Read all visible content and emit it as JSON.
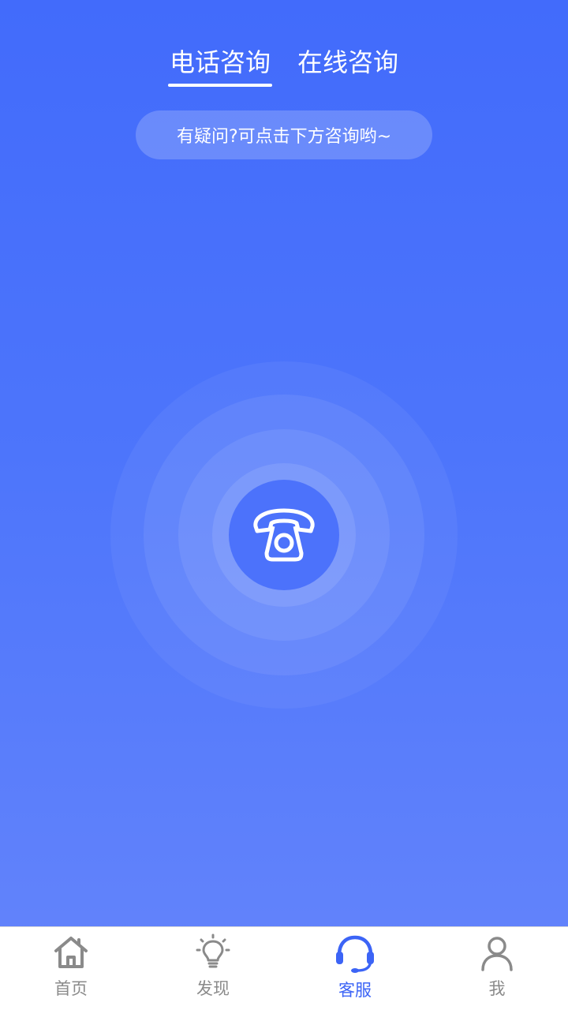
{
  "header": {
    "tabs": [
      {
        "label": "电话咨询",
        "active": true
      },
      {
        "label": "在线咨询",
        "active": false
      }
    ]
  },
  "hint": {
    "text": "有疑问?可点击下方咨询哟~"
  },
  "call": {
    "icon": "telephone-icon"
  },
  "tabbar": {
    "items": [
      {
        "label": "首页",
        "icon": "home-icon",
        "active": false
      },
      {
        "label": "发现",
        "icon": "lightbulb-icon",
        "active": false
      },
      {
        "label": "客服",
        "icon": "headset-icon",
        "active": true
      },
      {
        "label": "我",
        "icon": "user-icon",
        "active": false
      }
    ]
  },
  "colors": {
    "background_top": "#426bfb",
    "background_bottom": "#6585fb",
    "accent": "#3c64f6",
    "inactive": "#8a8a8a"
  }
}
